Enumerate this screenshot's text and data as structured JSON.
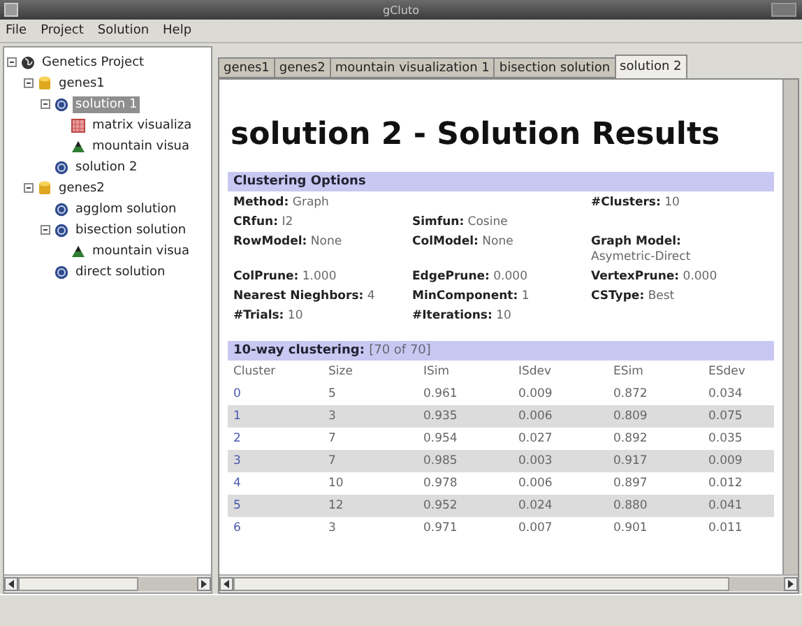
{
  "window": {
    "title": "gCluto"
  },
  "menu": [
    "File",
    "Project",
    "Solution",
    "Help"
  ],
  "tree": [
    {
      "label": "Genetics Project",
      "kind": "project",
      "expanded": true,
      "selected": false,
      "children": [
        {
          "label": "genes1",
          "kind": "dataset",
          "expanded": true,
          "selected": false,
          "children": [
            {
              "label": "solution 1",
              "kind": "solution",
              "expanded": true,
              "selected": true,
              "children": [
                {
                  "label": "matrix visualiza",
                  "kind": "matrix",
                  "selected": false
                },
                {
                  "label": "mountain visua",
                  "kind": "mountain",
                  "selected": false
                }
              ]
            },
            {
              "label": "solution 2",
              "kind": "solution",
              "selected": false
            }
          ]
        },
        {
          "label": "genes2",
          "kind": "dataset",
          "expanded": true,
          "selected": false,
          "children": [
            {
              "label": "agglom solution",
              "kind": "solution",
              "selected": false
            },
            {
              "label": "bisection solution",
              "kind": "solution",
              "expanded": true,
              "selected": false,
              "children": [
                {
                  "label": "mountain visua",
                  "kind": "mountain",
                  "selected": false
                }
              ]
            },
            {
              "label": "direct solution",
              "kind": "solution",
              "selected": false
            }
          ]
        }
      ]
    }
  ],
  "tabs": [
    {
      "label": "genes1",
      "selected": false
    },
    {
      "label": "genes2",
      "selected": false
    },
    {
      "label": "mountain visualization 1",
      "selected": false
    },
    {
      "label": "bisection solution",
      "selected": false
    },
    {
      "label": "solution 2",
      "selected": true
    }
  ],
  "heading": "solution 2 - Solution Results",
  "options": {
    "title": "Clustering Options",
    "rows": [
      {
        "column_1": {
          "label": "Method:",
          "value": "Graph"
        },
        "column_3": {
          "label": "#Clusters:",
          "value": "10"
        }
      },
      {
        "column_1": {
          "label": "CRfun:",
          "value": "I2"
        },
        "column_2": {
          "label": "Simfun:",
          "value": "Cosine"
        }
      },
      {
        "column_1": {
          "label": "RowModel:",
          "value": "None"
        },
        "column_2": {
          "label": "ColModel:",
          "value": "None"
        },
        "column_3": {
          "label": "Graph Model:",
          "value": "Asymetric-Direct"
        }
      },
      {
        "column_1": {
          "label": "ColPrune:",
          "value": "1.000"
        },
        "column_2": {
          "label": "EdgePrune:",
          "value": "0.000"
        },
        "column_3": {
          "label": "VertexPrune:",
          "value": "0.000"
        }
      },
      {
        "column_1": {
          "label": "Nearest Nieghbors:",
          "value": "4"
        },
        "column_2": {
          "label": "MinComponent:",
          "value": "1"
        },
        "column_3": {
          "label": "CSType:",
          "value": "Best"
        }
      },
      {
        "column_1": {
          "label": "#Trials:",
          "value": "10"
        },
        "column_2": {
          "label": "#Iterations:",
          "value": "10"
        }
      }
    ]
  },
  "clustering": {
    "title": "10-way clustering:",
    "count": "[70 of 70]",
    "columns": [
      "Cluster",
      "Size",
      "ISim",
      "ISdev",
      "ESim",
      "ESdev"
    ],
    "rows": [
      [
        "0",
        "5",
        "0.961",
        "0.009",
        "0.872",
        "0.034"
      ],
      [
        "1",
        "3",
        "0.935",
        "0.006",
        "0.809",
        "0.075"
      ],
      [
        "2",
        "7",
        "0.954",
        "0.027",
        "0.892",
        "0.035"
      ],
      [
        "3",
        "7",
        "0.985",
        "0.003",
        "0.917",
        "0.009"
      ],
      [
        "4",
        "10",
        "0.978",
        "0.006",
        "0.897",
        "0.012"
      ],
      [
        "5",
        "12",
        "0.952",
        "0.024",
        "0.880",
        "0.041"
      ],
      [
        "6",
        "3",
        "0.971",
        "0.007",
        "0.901",
        "0.011"
      ]
    ]
  }
}
